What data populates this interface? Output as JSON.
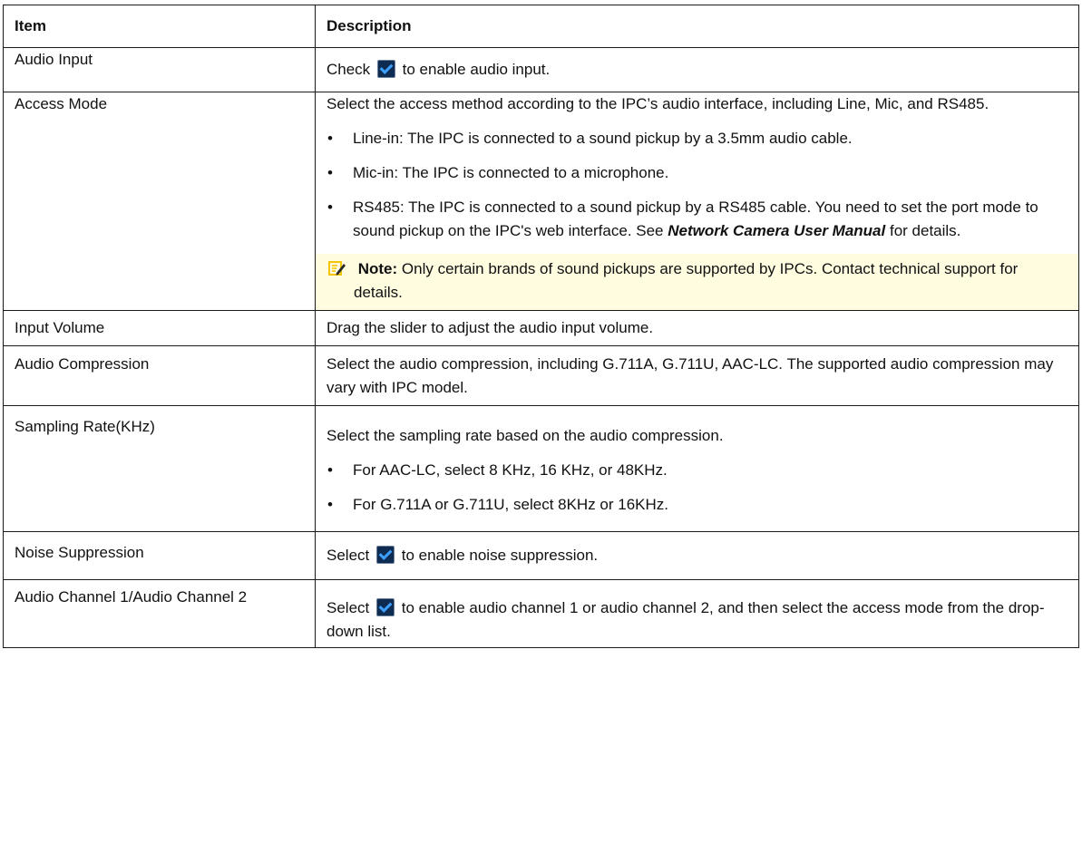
{
  "table": {
    "header": {
      "item": "Item",
      "description": "Description"
    },
    "rows": [
      {
        "item": "Audio Input",
        "desc": {
          "before": "Check",
          "after": "to enable audio input."
        }
      },
      {
        "item": "Access Mode",
        "desc": {
          "para": "Select the access method according to the IPC’s audio interface, including Line, Mic, and RS485.",
          "bullets": [
            "Line-in: The IPC is connected to a sound pickup by a 3.5mm audio cable.",
            "Mic-in: The IPC is connected to a microphone."
          ],
          "rs485": {
            "text": "RS485: The IPC is connected to a sound pickup by a RS485 cable. You need to set the port mode to sound pickup on the IPC's web interface. See",
            "manual": "Network Camera User Manual",
            "after": "for details."
          },
          "note": {
            "label": "Note:",
            "text": "Only certain brands of sound pickups are supported by IPCs. Contact technical support for details."
          }
        }
      },
      {
        "item": "Input Volume",
        "desc": {
          "para": "Drag the slider to adjust the audio input volume."
        }
      },
      {
        "item": "Audio Compression",
        "desc": {
          "para": "Select the audio compression, including G.711A, G.711U, AAC-LC. The supported audio compression may vary with IPC model."
        }
      },
      {
        "item": "Sampling Rate(KHz)",
        "desc": {
          "para": "Select the sampling rate based on the audio compression.",
          "bullets": [
            "For AAC-LC, select 8 KHz, 16 KHz, or 48KHz.",
            "For G.711A or G.711U, select 8KHz or 16KHz."
          ]
        }
      },
      {
        "item": "Noise Suppression",
        "desc": {
          "before": "Select",
          "after": "to enable noise suppression."
        }
      },
      {
        "item": "Audio Channel 1/Audio Channel 2",
        "desc": {
          "before": "Select",
          "after": "to enable audio channel 1 or audio channel 2, and then select the access mode from the drop-down list."
        }
      }
    ]
  },
  "icons": {
    "checkbox": "checkbox-checked-icon",
    "note": "note-pencil-icon"
  },
  "colors": {
    "note_bg": "#fffce0",
    "note_icon": "#f5c400",
    "checkbox_bg": "#0e2b52",
    "checkbox_tick": "#3da0ff"
  }
}
